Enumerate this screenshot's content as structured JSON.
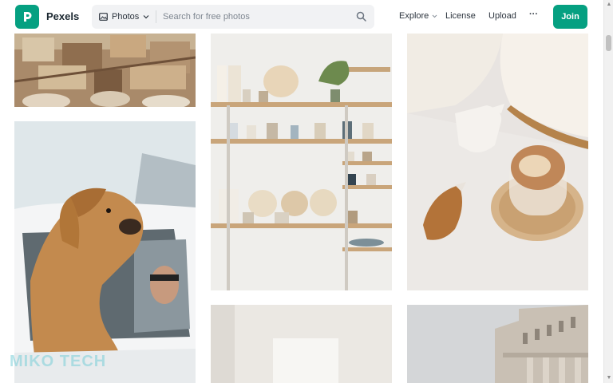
{
  "header": {
    "logo_text": "Pexels",
    "search": {
      "type_label": "Photos",
      "placeholder": "Search for free photos"
    },
    "nav": {
      "explore": "Explore",
      "license": "License",
      "upload": "Upload",
      "more": "···"
    },
    "join_label": "Join"
  },
  "colors": {
    "brand": "#05a081",
    "search_bg": "#f1f2f4",
    "text": "#2c343e"
  },
  "photos": [
    {
      "column": 1,
      "subject": "aerial city buildings"
    },
    {
      "column": 1,
      "subject": "golden retriever dog in car window"
    },
    {
      "column": 2,
      "subject": "shelves with ceramic dishes"
    },
    {
      "column": 2,
      "subject": "white wall room"
    },
    {
      "column": 3,
      "subject": "latte coffee on table with pitcher"
    },
    {
      "column": 3,
      "subject": "classical building facade"
    }
  ],
  "watermark": "MIKO TECH"
}
